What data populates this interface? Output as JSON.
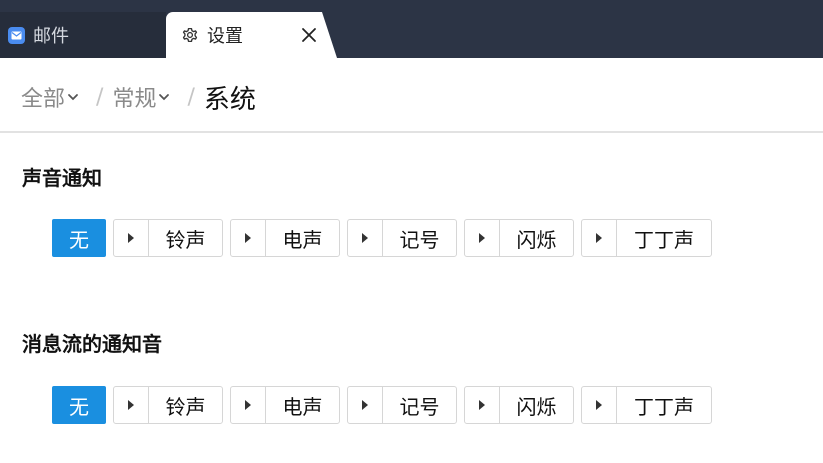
{
  "tabs": {
    "mail_label": "邮件",
    "settings_label": "设置"
  },
  "breadcrumb": {
    "items": [
      "全部",
      "常规"
    ],
    "separator": "/",
    "current": "系统"
  },
  "sections": [
    {
      "title": "声音通知",
      "selected": "无",
      "options": [
        "铃声",
        "电声",
        "记号",
        "闪烁",
        "丁丁声"
      ]
    },
    {
      "title": "消息流的通知音",
      "selected": "无",
      "options": [
        "铃声",
        "电声",
        "记号",
        "闪烁",
        "丁丁声"
      ]
    }
  ],
  "colors": {
    "tabbar": "#2c3445",
    "accent": "#1a8fe0",
    "mail_icon": "#4a8cf0"
  },
  "icons": [
    "mail-app-icon",
    "gear-icon",
    "close-icon",
    "chevron-down-icon",
    "play-icon"
  ]
}
